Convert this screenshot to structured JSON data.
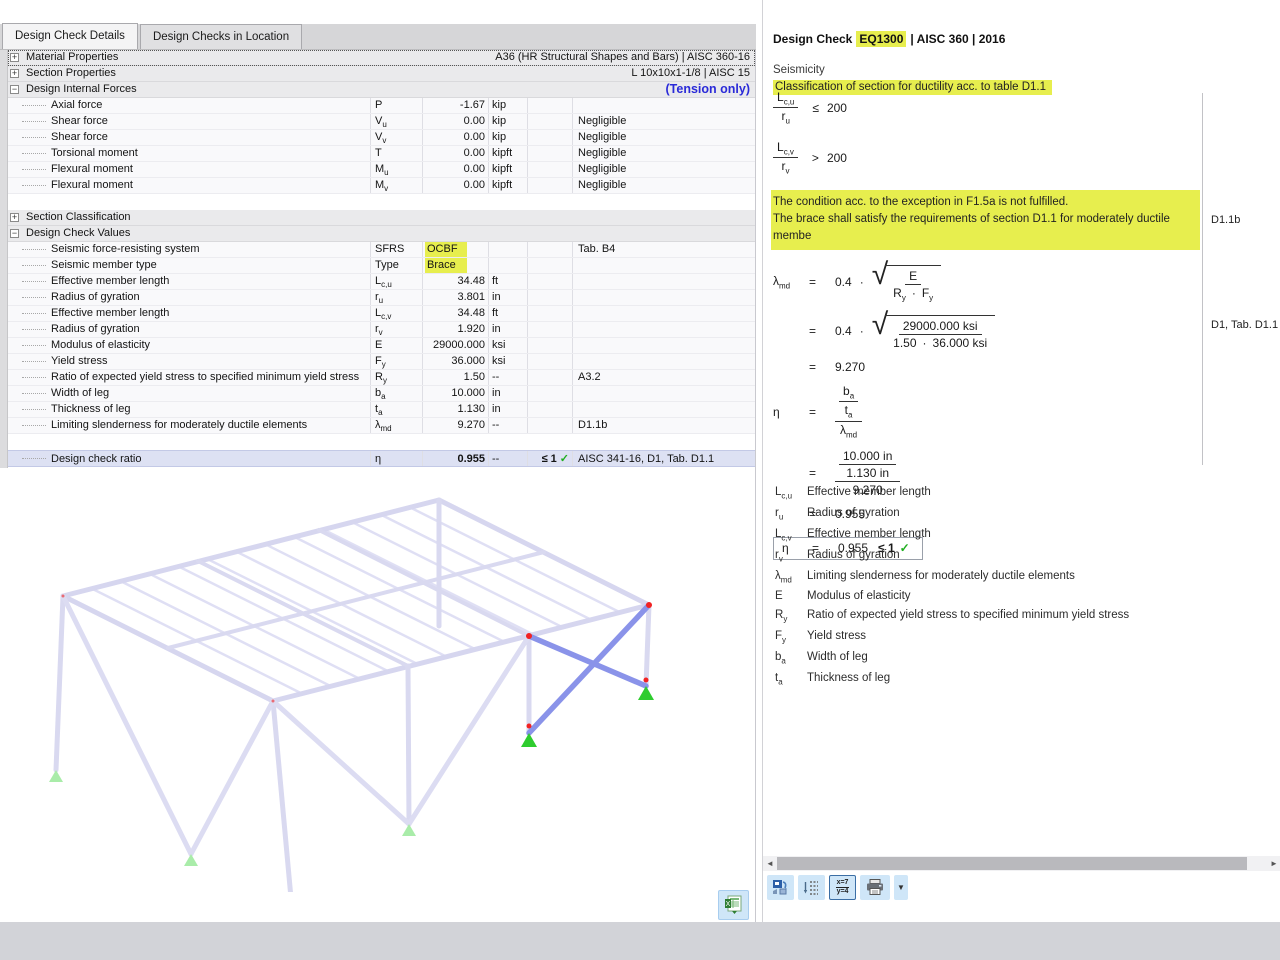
{
  "colors": {
    "highlight_yellow": "#e7ee4e",
    "tension_blue": "#2a2ad8",
    "ratio_row_bg": "#dde1f3",
    "check_green": "#1fae1f",
    "member_lavender": "#d9d9f0",
    "brace_blue": "#8a93e9",
    "support_green": "#3ddc3d",
    "node_red": "#f22222"
  },
  "tabs": [
    {
      "label": "Design Check Details",
      "active": true
    },
    {
      "label": "Design Checks in Location",
      "active": false
    }
  ],
  "table": {
    "rows": [
      {
        "t": "sec",
        "ex": "+",
        "label": "Material Properties",
        "right": "A36 (HR Structural Shapes and Bars) | AISC 360-16",
        "focus": true
      },
      {
        "t": "sec",
        "ex": "+",
        "label": "Section Properties",
        "right": "L 10x10x1-1/8 | AISC 15"
      },
      {
        "t": "sec",
        "ex": "−",
        "label": "Design Internal Forces",
        "right": "(Tension only)",
        "rightBlue": true
      },
      {
        "t": "item",
        "label": "Axial force",
        "sym": "P",
        "val": "-1.67",
        "unit": "kip"
      },
      {
        "t": "item",
        "label": "Shear force",
        "sym": "V",
        "sub": "u",
        "val": "0.00",
        "unit": "kip",
        "ref": "Negligible"
      },
      {
        "t": "item",
        "label": "Shear force",
        "sym": "V",
        "sub": "v",
        "val": "0.00",
        "unit": "kip",
        "ref": "Negligible"
      },
      {
        "t": "item",
        "label": "Torsional moment",
        "sym": "T",
        "val": "0.00",
        "unit": "kipft",
        "ref": "Negligible"
      },
      {
        "t": "item",
        "label": "Flexural moment",
        "sym": "M",
        "sub": "u",
        "val": "0.00",
        "unit": "kipft",
        "ref": "Negligible"
      },
      {
        "t": "item",
        "label": "Flexural moment",
        "sym": "M",
        "sub": "v",
        "val": "0.00",
        "unit": "kipft",
        "ref": "Negligible"
      },
      {
        "t": "sp"
      },
      {
        "t": "sec",
        "ex": "+",
        "label": "Section Classification"
      },
      {
        "t": "sec",
        "ex": "−",
        "label": "Design Check Values"
      },
      {
        "t": "item",
        "label": "Seismic force-resisting system",
        "sym": "SFRS",
        "val": "OCBF",
        "valText": true,
        "valHl": true,
        "ref": "Tab. B4"
      },
      {
        "t": "item",
        "label": "Seismic member type",
        "sym": "Type",
        "val": "Brace",
        "valText": true,
        "valHl": true
      },
      {
        "t": "item",
        "label": "Effective member length",
        "sym": "L",
        "sub": "c,u",
        "val": "34.48",
        "unit": "ft"
      },
      {
        "t": "item",
        "label": "Radius of gyration",
        "sym": "r",
        "sub": "u",
        "val": "3.801",
        "unit": "in"
      },
      {
        "t": "item",
        "label": "Effective member length",
        "sym": "L",
        "sub": "c,v",
        "val": "34.48",
        "unit": "ft"
      },
      {
        "t": "item",
        "label": "Radius of gyration",
        "sym": "r",
        "sub": "v",
        "val": "1.920",
        "unit": "in"
      },
      {
        "t": "item",
        "label": "Modulus of elasticity",
        "sym": "E",
        "val": "29000.000",
        "unit": "ksi"
      },
      {
        "t": "item",
        "label": "Yield stress",
        "sym": "F",
        "sub": "y",
        "val": "36.000",
        "unit": "ksi"
      },
      {
        "t": "item",
        "label": "Ratio of expected yield stress to specified minimum yield stress",
        "sym": "R",
        "sub": "y",
        "val": "1.50",
        "unit": "--",
        "ref": "A3.2"
      },
      {
        "t": "item",
        "label": "Width of leg",
        "sym": "b",
        "sub": "a",
        "val": "10.000",
        "unit": "in"
      },
      {
        "t": "item",
        "label": "Thickness of leg",
        "sym": "t",
        "sub": "a",
        "val": "1.130",
        "unit": "in"
      },
      {
        "t": "item",
        "label": "Limiting slenderness for moderately ductile elements",
        "sym": "λ",
        "sub": "md",
        "val": "9.270",
        "unit": "--",
        "ref": "D1.1b"
      },
      {
        "t": "sp"
      },
      {
        "t": "ratio",
        "label": "Design check ratio",
        "sym": "η",
        "val": "0.955",
        "unit": "--",
        "crit": "≤ 1",
        "check": true,
        "ref": "AISC 341-16, D1, Tab. D1.1"
      }
    ]
  },
  "right": {
    "title": {
      "pre": "Design Check",
      "hl": "EQ1300",
      "post": "| AISC 360 | 2016"
    },
    "section_label": "Seismicity",
    "classification": "Classification of section for ductility acc. to table D1.1",
    "rad": "√",
    "f1": {
      "num": "L",
      "numsub": "c,u",
      "den": "r",
      "densub": "u",
      "op": "≤",
      "rhs": "200"
    },
    "f2": {
      "num": "L",
      "numsub": "c,v",
      "den": "r",
      "densub": "v",
      "op": ">",
      "rhs": "200"
    },
    "warning": {
      "line1": "The condition acc. to the exception in F1.5a is not fulfilled.",
      "line2": "The brace shall satisfy the requirements of section D1.1 for moderately ductile membe"
    },
    "lambda": {
      "lhs": "λ",
      "lhssub": "md",
      "eq": "=",
      "coef": "0.4",
      "dot": "·",
      "num": "E",
      "den1": "R",
      "den1sub": "y",
      "den2": "F",
      "den2sub": "y",
      "num2": "29000.000 ksi",
      "den21": "1.50",
      "den22": "36.000 ksi",
      "res": "9.270",
      "ref": "D1.1b"
    },
    "eta": {
      "lhs": "η",
      "eq": "=",
      "n_num": "b",
      "n_numsub": "a",
      "n_den": "t",
      "n_densub": "a",
      "den": "λ",
      "densub": "md",
      "v_nnum": "10.000 in",
      "v_nden": "1.130 in",
      "v_den": "9.270",
      "res": "0.955",
      "ref": "D1, Tab. D1.1"
    },
    "final": {
      "lhs": "η",
      "eq": "=",
      "val": "0.955",
      "cond": "≤ 1",
      "check": "✓"
    },
    "legend": [
      {
        "s": "L",
        "sub": "c,u",
        "d": "Effective member length"
      },
      {
        "s": "r",
        "sub": "u",
        "d": "Radius of gyration"
      },
      {
        "s": "L",
        "sub": "c,v",
        "d": "Effective member length"
      },
      {
        "s": "r",
        "sub": "v",
        "d": "Radius of gyration"
      },
      {
        "s": "λ",
        "sub": "md",
        "d": "Limiting slenderness for moderately ductile elements"
      },
      {
        "s": "E",
        "sub": "",
        "d": "Modulus of elasticity"
      },
      {
        "s": "R",
        "sub": "y",
        "d": "Ratio of expected yield stress to specified minimum yield stress"
      },
      {
        "s": "F",
        "sub": "y",
        "d": "Yield stress"
      },
      {
        "s": "b",
        "sub": "a",
        "d": "Width of leg"
      },
      {
        "s": "t",
        "sub": "a",
        "d": "Thickness of leg"
      }
    ]
  },
  "toolbar": {
    "values_icon": {
      "top": "x=7",
      "bottom": "y=4"
    },
    "scroll_left": "◄",
    "scroll_right": "►",
    "caret": "▼"
  }
}
